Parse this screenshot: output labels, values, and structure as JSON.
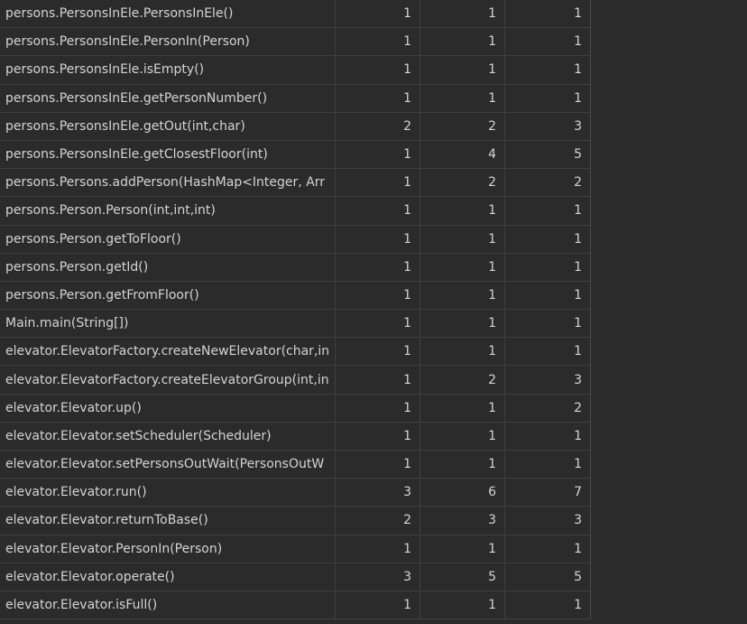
{
  "rows": [
    {
      "method": "persons.PersonsInEle.PersonsInEle()",
      "c1": "1",
      "c2": "1",
      "c3": "1"
    },
    {
      "method": "persons.PersonsInEle.PersonIn(Person)",
      "c1": "1",
      "c2": "1",
      "c3": "1"
    },
    {
      "method": "persons.PersonsInEle.isEmpty()",
      "c1": "1",
      "c2": "1",
      "c3": "1"
    },
    {
      "method": "persons.PersonsInEle.getPersonNumber()",
      "c1": "1",
      "c2": "1",
      "c3": "1"
    },
    {
      "method": "persons.PersonsInEle.getOut(int,char)",
      "c1": "2",
      "c2": "2",
      "c3": "3"
    },
    {
      "method": "persons.PersonsInEle.getClosestFloor(int)",
      "c1": "1",
      "c2": "4",
      "c3": "5"
    },
    {
      "method": "persons.Persons.addPerson(HashMap<Integer, Arr",
      "c1": "1",
      "c2": "2",
      "c3": "2"
    },
    {
      "method": "persons.Person.Person(int,int,int)",
      "c1": "1",
      "c2": "1",
      "c3": "1"
    },
    {
      "method": "persons.Person.getToFloor()",
      "c1": "1",
      "c2": "1",
      "c3": "1"
    },
    {
      "method": "persons.Person.getId()",
      "c1": "1",
      "c2": "1",
      "c3": "1"
    },
    {
      "method": "persons.Person.getFromFloor()",
      "c1": "1",
      "c2": "1",
      "c3": "1"
    },
    {
      "method": "Main.main(String[])",
      "c1": "1",
      "c2": "1",
      "c3": "1"
    },
    {
      "method": "elevator.ElevatorFactory.createNewElevator(char,in",
      "c1": "1",
      "c2": "1",
      "c3": "1"
    },
    {
      "method": "elevator.ElevatorFactory.createElevatorGroup(int,in",
      "c1": "1",
      "c2": "2",
      "c3": "3"
    },
    {
      "method": "elevator.Elevator.up()",
      "c1": "1",
      "c2": "1",
      "c3": "2"
    },
    {
      "method": "elevator.Elevator.setScheduler(Scheduler)",
      "c1": "1",
      "c2": "1",
      "c3": "1"
    },
    {
      "method": "elevator.Elevator.setPersonsOutWait(PersonsOutW",
      "c1": "1",
      "c2": "1",
      "c3": "1"
    },
    {
      "method": "elevator.Elevator.run()",
      "c1": "3",
      "c2": "6",
      "c3": "7"
    },
    {
      "method": "elevator.Elevator.returnToBase()",
      "c1": "2",
      "c2": "3",
      "c3": "3"
    },
    {
      "method": "elevator.Elevator.PersonIn(Person)",
      "c1": "1",
      "c2": "1",
      "c3": "1"
    },
    {
      "method": "elevator.Elevator.operate()",
      "c1": "3",
      "c2": "5",
      "c3": "5"
    },
    {
      "method": "elevator.Elevator.isFull()",
      "c1": "1",
      "c2": "1",
      "c3": "1"
    }
  ],
  "colors": {
    "background": "#2b2b2b",
    "text": "#d4d4d4",
    "grid": "#3f3f3f"
  }
}
